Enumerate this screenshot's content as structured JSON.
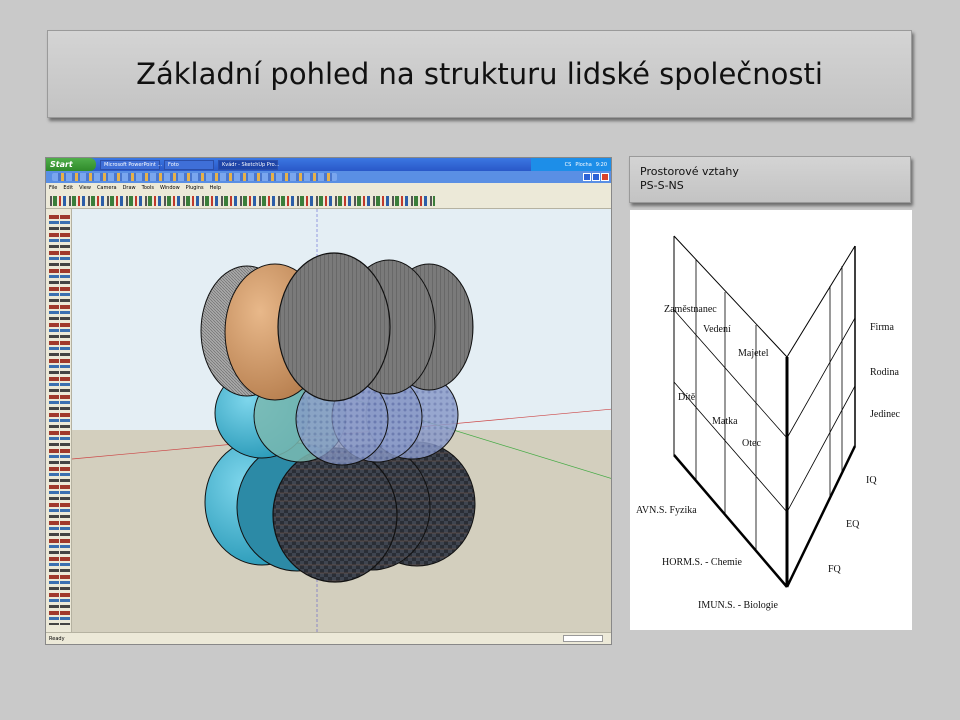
{
  "slide": {
    "title": "Základní pohled na strukturu lidské společnosti"
  },
  "screenshot": {
    "taskbar": {
      "start_label": "Start",
      "tasks": [
        "Microsoft PowerPoint ...",
        "Foto",
        "Kvádr - SketchUp Pro..."
      ],
      "tray_language": "CS",
      "tray_search": "Plocha",
      "tray_clock": "9:20"
    },
    "menu": [
      "File",
      "Edit",
      "View",
      "Camera",
      "Draw",
      "Tools",
      "Window",
      "Plugins",
      "Help"
    ],
    "status_text": "Ready"
  },
  "panel": {
    "caption_line1": "Prostorové vztahy",
    "caption_line2": "PS-S-NS"
  },
  "diagram": {
    "left_labels": {
      "zamestnanec": "Zaměstnanec",
      "vedeni": "Vedení",
      "majetel": "Majetel",
      "dite": "Dítě",
      "matka": "Matka",
      "otec": "Otec",
      "avns": "AVN.S. Fyzika",
      "horms": "HORM.S. - Chemie",
      "imuns": "IMUN.S. - Biologie"
    },
    "right_labels": {
      "firma": "Firma",
      "rodina": "Rodina",
      "jedinec": "Jedinec",
      "iq": "IQ",
      "eq": "EQ",
      "fq": "FQ"
    }
  },
  "colors": {
    "slide_bg": "#c9c9c9",
    "xp_blue": "#2a58c8",
    "start_green": "#3a9a35"
  }
}
